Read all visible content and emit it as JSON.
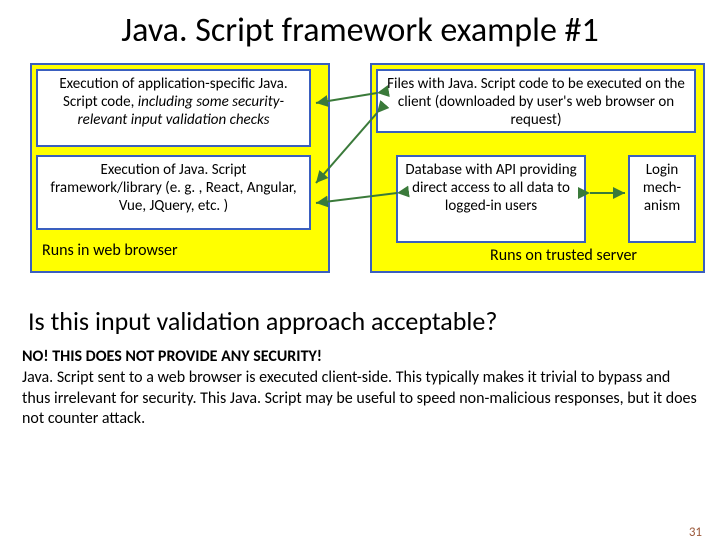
{
  "title": "Java. Script framework example #1",
  "boxes": {
    "app_exec_pre": "Execution of application-specific Java. Script code, ",
    "app_exec_italic": "including some security-relevant input validation checks",
    "framework_exec": "Execution of Java. Script framework/library (e. g. , React, Angular, Vue, JQuery, etc. )",
    "files_js": "Files with Java. Script code to be executed on the client (downloaded by user's web browser on request)",
    "db_api": "Database with API providing direct access to all data to logged-in users",
    "login": "Login mech-anism"
  },
  "col_labels": {
    "left": "Runs in web browser",
    "right": "Runs on trusted server"
  },
  "question": "Is this input validation approach acceptable?",
  "answer_bold": "NO!  THIS DOES NOT PROVIDE ANY SECURITY!",
  "answer_rest": "Java. Script sent to a web browser is executed client-side.  This typically makes it trivial to bypass and thus irrelevant for security.  This Java. Script may be useful to speed non-malicious responses, but it does not counter attack.",
  "page_number": "31"
}
